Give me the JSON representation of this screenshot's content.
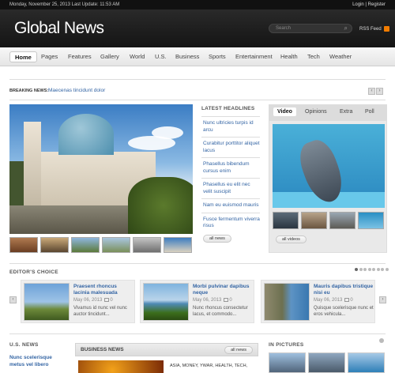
{
  "topbar": {
    "date": "Monday, November 25, 2013 Last Update: 11:53 AM",
    "login": "Login | Register"
  },
  "header": {
    "logo": "Global News",
    "search_placeholder": "Search",
    "rss": "RSS Feed"
  },
  "nav": {
    "items": [
      "Home",
      "Pages",
      "Features",
      "Gallery",
      "World",
      "U.S.",
      "Business",
      "Sports",
      "Entertainment",
      "Health",
      "Tech",
      "Weather"
    ],
    "active": "Home"
  },
  "breaking": {
    "label": "BREAKING NEWS:",
    "text": "Maecenas tincidunt dolor"
  },
  "latest": {
    "title": "LATEST HEADLINES",
    "items": [
      "Nunc ultricies turpis id arcu",
      "Curabitur porttitor aliquet lacus",
      "Phasellus bibendum cursus enim",
      "Phasellus eu elit nec velit suscipit",
      "Nam eu euismod mauris",
      "Fusce fermentum viverra risus"
    ],
    "button": "all news"
  },
  "video_box": {
    "tabs": [
      "Video",
      "Opinions",
      "Extra",
      "Poll"
    ],
    "active_tab": "Video",
    "button": "all videos"
  },
  "editors_choice": {
    "title": "EDITOR'S CHOICE",
    "cards": [
      {
        "title": "Praesent rhoncus lacinia malesuada",
        "date": "May 06, 2013",
        "comments": "0",
        "excerpt": "Vivamus id nunc vel nunc auctor tincidunt..."
      },
      {
        "title": "Morbi pulvinar dapibus neque",
        "date": "May 06, 2013",
        "comments": "0",
        "excerpt": "Nunc rhoncus consectetur lacus, et commodo..."
      },
      {
        "title": "Mauris dapibus tristique nisi eu",
        "date": "May 06, 2013",
        "comments": "0",
        "excerpt": "Quisque scelerisque nunc et eros vehicula..."
      }
    ]
  },
  "us_news": {
    "title": "U.S. NEWS",
    "first_link": "Nunc scelerisque metus vel libero"
  },
  "business_news": {
    "title": "BUSINESS NEWS",
    "button": "all news",
    "tags": "ASIA, MONEY, YWAR, HEALTH, TECH,"
  },
  "in_pictures": {
    "title": "IN PICTURES"
  },
  "colors": {
    "link": "#3465a4",
    "header_bg": "#141414",
    "rss": "#f27c00"
  }
}
